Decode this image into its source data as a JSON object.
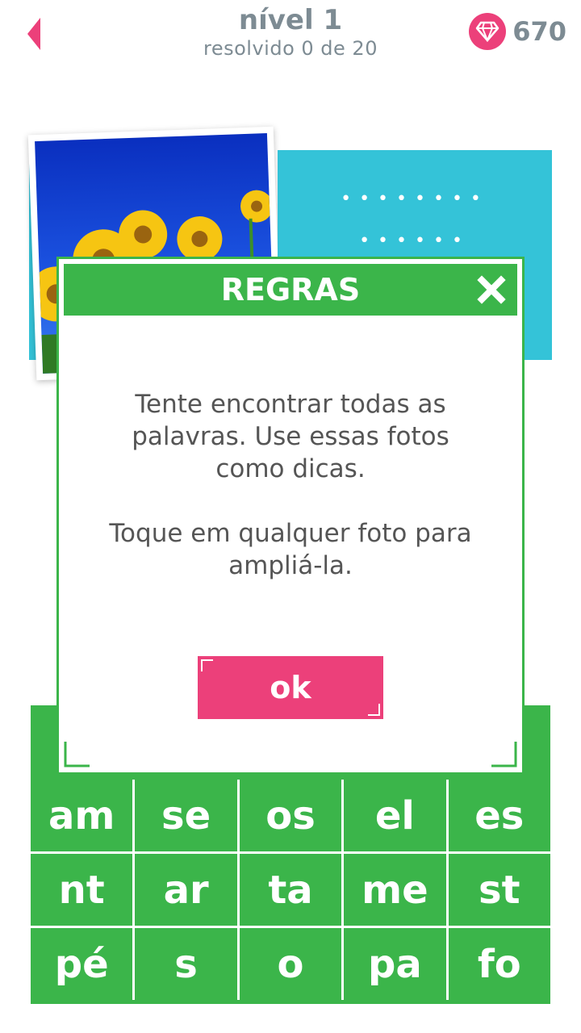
{
  "header": {
    "title": "nível 1",
    "subtitle": "resolvido 0 de 20",
    "gems": "670"
  },
  "background_card": {
    "dots_row1": "••••••••",
    "dots_row2": "••••••"
  },
  "grid": {
    "tiles": [
      "am",
      "se",
      "os",
      "el",
      "es",
      "nt",
      "ar",
      "ta",
      "me",
      "st",
      "pé",
      "s",
      "o",
      "pa",
      "fo"
    ]
  },
  "modal": {
    "title": "REGRAS",
    "paragraph1_line1": "Tente encontrar todas as",
    "paragraph1_line2": "palavras. Use essas fotos",
    "paragraph1_line3": "como dicas.",
    "paragraph2_line1": "Toque em qualquer foto para",
    "paragraph2_line2": "ampliá-la.",
    "ok_label": "ok"
  },
  "colors": {
    "accent_pink": "#ec407a",
    "green": "#3bb54a",
    "cyan": "#34c3d8",
    "header_gray": "#7d8b93"
  },
  "icons": [
    "back-arrow-icon",
    "diamond-icon",
    "close-icon"
  ]
}
